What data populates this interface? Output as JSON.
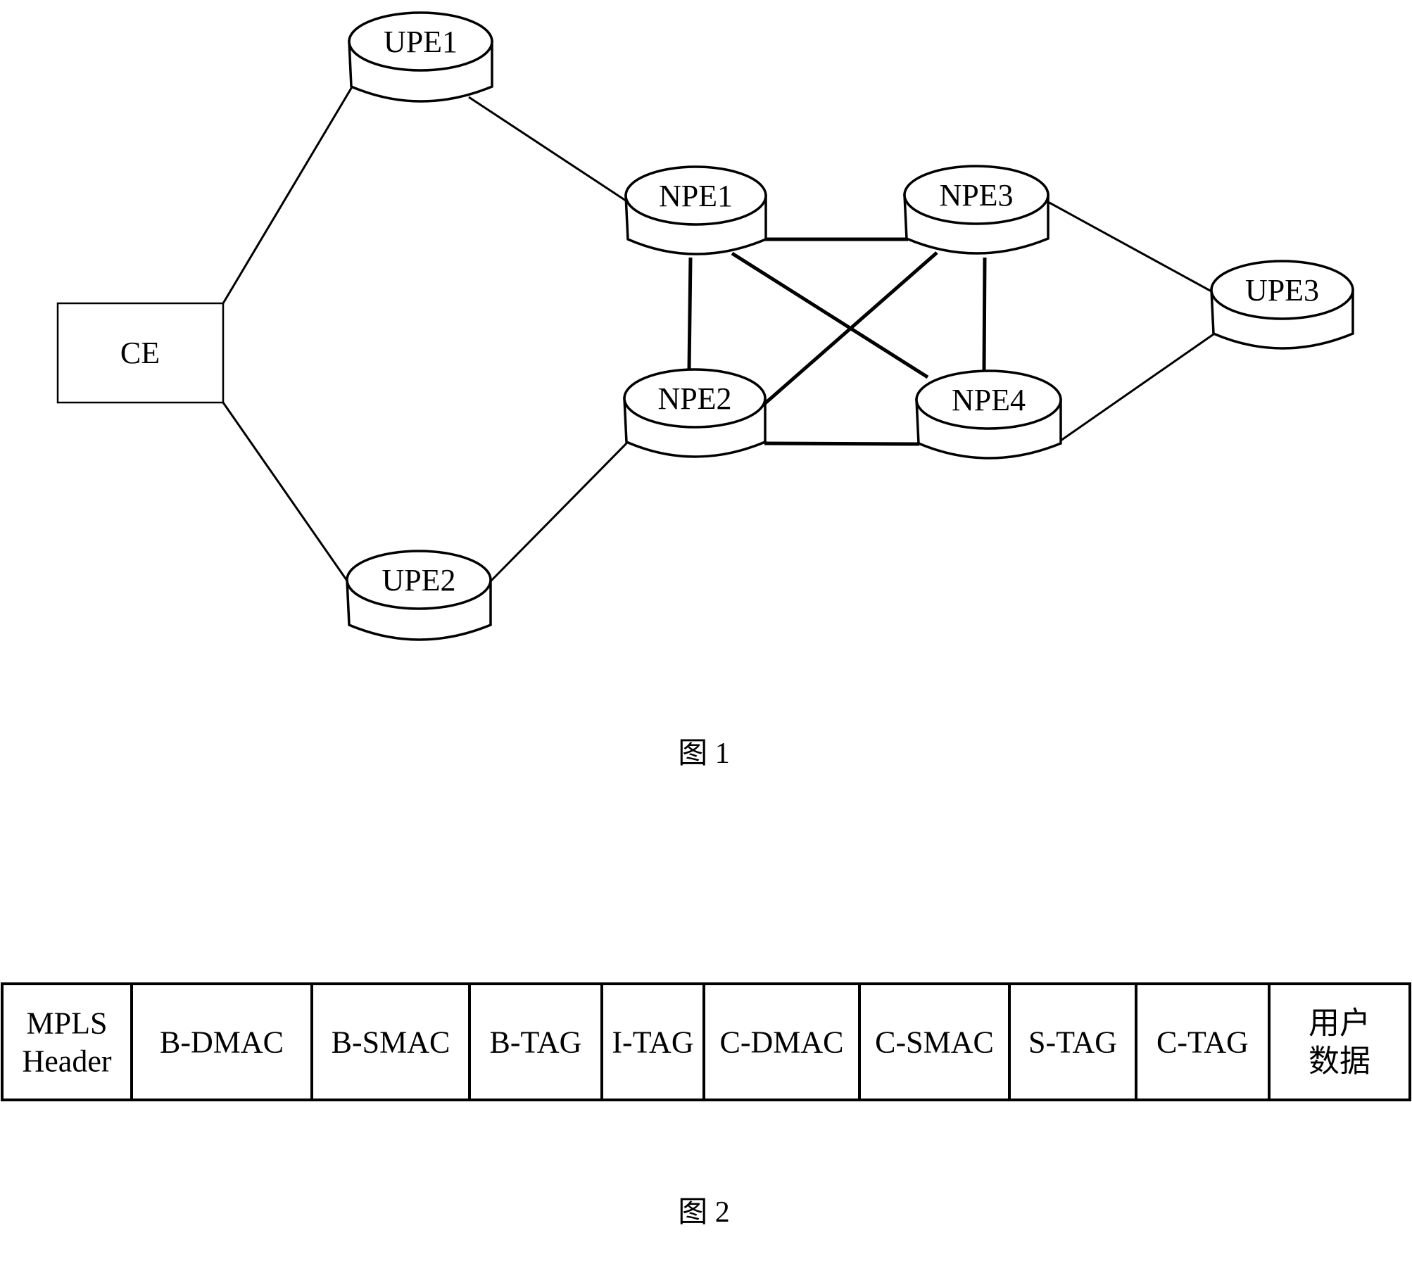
{
  "figure1": {
    "caption": "图 1",
    "ce": {
      "label": "CE"
    },
    "nodes": [
      {
        "id": "UPE1",
        "label": "UPE1",
        "kind": "upe"
      },
      {
        "id": "UPE2",
        "label": "UPE2",
        "kind": "upe"
      },
      {
        "id": "UPE3",
        "label": "UPE3",
        "kind": "upe"
      },
      {
        "id": "NPE1",
        "label": "NPE1",
        "kind": "npe"
      },
      {
        "id": "NPE2",
        "label": "NPE2",
        "kind": "npe"
      },
      {
        "id": "NPE3",
        "label": "NPE3",
        "kind": "npe"
      },
      {
        "id": "NPE4",
        "label": "NPE4",
        "kind": "npe"
      }
    ],
    "links": [
      {
        "from": "CE",
        "to": "UPE1",
        "style": "thin"
      },
      {
        "from": "CE",
        "to": "UPE2",
        "style": "thin"
      },
      {
        "from": "UPE1",
        "to": "NPE1",
        "style": "thin"
      },
      {
        "from": "UPE2",
        "to": "NPE2",
        "style": "thin"
      },
      {
        "from": "NPE1",
        "to": "NPE2",
        "style": "thick"
      },
      {
        "from": "NPE1",
        "to": "NPE3",
        "style": "thick"
      },
      {
        "from": "NPE1",
        "to": "NPE4",
        "style": "thick"
      },
      {
        "from": "NPE2",
        "to": "NPE3",
        "style": "thick"
      },
      {
        "from": "NPE2",
        "to": "NPE4",
        "style": "thick"
      },
      {
        "from": "NPE3",
        "to": "NPE4",
        "style": "thick"
      },
      {
        "from": "NPE3",
        "to": "UPE3",
        "style": "thin"
      },
      {
        "from": "NPE4",
        "to": "UPE3",
        "style": "thin"
      }
    ]
  },
  "figure2": {
    "caption": "图 2",
    "fields": [
      {
        "lines": [
          "MPLS",
          "Header"
        ]
      },
      {
        "lines": [
          "B-DMAC"
        ]
      },
      {
        "lines": [
          "B-SMAC"
        ]
      },
      {
        "lines": [
          "B-TAG"
        ]
      },
      {
        "lines": [
          "I-TAG"
        ]
      },
      {
        "lines": [
          "C-DMAC"
        ]
      },
      {
        "lines": [
          "C-SMAC"
        ]
      },
      {
        "lines": [
          "S-TAG"
        ]
      },
      {
        "lines": [
          "C-TAG"
        ]
      },
      {
        "lines": [
          "用户",
          "数据"
        ]
      }
    ]
  }
}
